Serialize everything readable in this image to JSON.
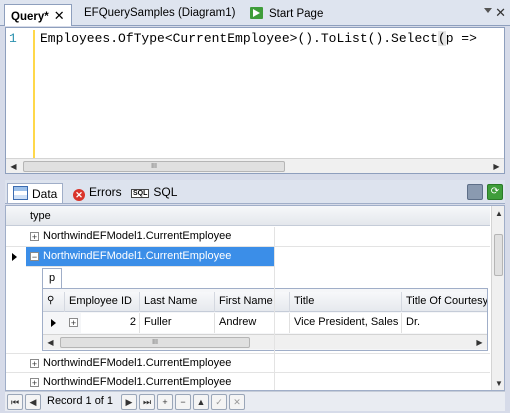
{
  "tabs": {
    "query": "Query*",
    "close": "✕",
    "diagram": "EFQuerySamples (Diagram1)",
    "start": "Start Page"
  },
  "editor": {
    "line_number": "1",
    "code_before": "Employees.OfType<CurrentEmployee>().ToList().Select",
    "code_brace": "(",
    "code_after": "p =>",
    "scroll_grip": "III"
  },
  "results": {
    "tab_data": "Data",
    "tab_errors": "Errors",
    "tab_sql": "SQL",
    "column_header": "type",
    "rows": [
      {
        "label": "NorthwindEFModel1.CurrentEmployee",
        "expanded": false,
        "selected": false
      },
      {
        "label": "NorthwindEFModel1.CurrentEmployee",
        "expanded": true,
        "selected": true
      },
      {
        "label": "NorthwindEFModel1.CurrentEmployee",
        "expanded": false,
        "selected": false
      },
      {
        "label": "NorthwindEFModel1.CurrentEmployee",
        "expanded": false,
        "selected": false
      }
    ],
    "detail": {
      "tab": "p",
      "columns": [
        "Employee ID",
        "Last Name",
        "First Name",
        "Title",
        "Title Of Courtesy"
      ],
      "values": [
        "2",
        "Fuller",
        "Andrew",
        "Vice President, Sales",
        "Dr."
      ],
      "scroll_grip": "III"
    }
  },
  "navigator": {
    "record_label": "Record 1 of 1"
  },
  "colors": {
    "selection": "#3b8ee8",
    "line_number": "#2b91af",
    "change_marker": "#ffd84a"
  }
}
